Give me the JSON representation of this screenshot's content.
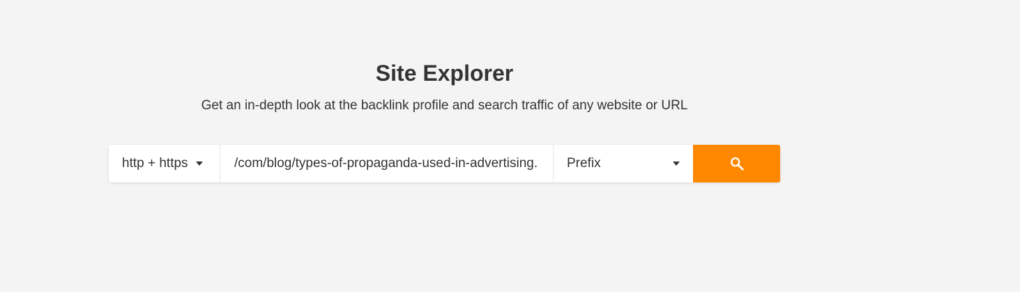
{
  "header": {
    "title": "Site Explorer",
    "subtitle": "Get an in-depth look at the backlink profile and search traffic of any website or URL"
  },
  "search": {
    "protocol": {
      "selected": "http + https",
      "icon": "caret-down-icon"
    },
    "url": {
      "value": ".com/blog/types-of-propaganda-used-in-advertising/"
    },
    "mode": {
      "selected": "Prefix",
      "icon": "caret-down-icon"
    },
    "button": {
      "icon": "search-icon"
    }
  },
  "colors": {
    "background": "#f4f4f4",
    "accent": "#ff8800",
    "text": "#333333",
    "field": "#ffffff"
  }
}
